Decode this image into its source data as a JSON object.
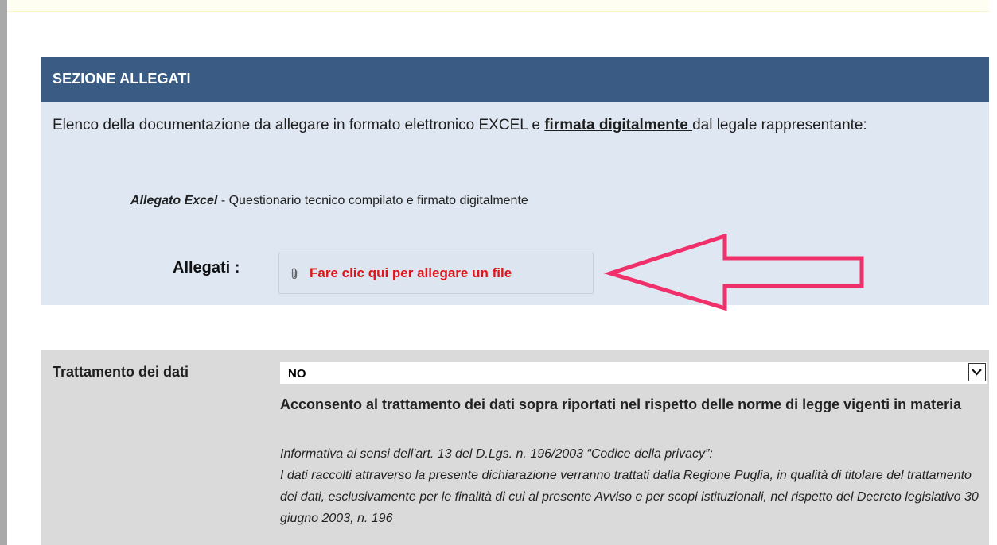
{
  "section": {
    "title": "SEZIONE ALLEGATI",
    "intro_before": "Elenco della documentazione da allegare in formato elettronico EXCEL e ",
    "intro_emphasis": "firmata digitalmente ",
    "intro_after": "dal legale rappresentante:",
    "item_title": "Allegato Excel",
    "item_desc": " - Questionario tecnico compilato e firmato digitalmente",
    "attach_label": "Allegati :",
    "attach_link": "Fare clic qui per allegare un file"
  },
  "privacy": {
    "label": "Trattamento dei dati",
    "selected": "NO",
    "consent": "Acconsento al trattamento dei dati sopra riportati nel rispetto delle norme di legge vigenti in materia",
    "note_heading": "Informativa ai sensi dell'art. 13 del D.Lgs. n. 196/2003 “Codice della privacy”:",
    "note_body": "I dati raccolti attraverso la presente dichiarazione verranno trattati dalla Regione Puglia, in qualità di titolare del trattamento dei dati, esclusivamente per le finalità di cui al presente Avviso e per scopi istituzionali, nel rispetto del Decreto legislativo 30 giugno 2003, n. 196"
  },
  "icons": {
    "attach": "paperclip-icon",
    "dropdown": "chevron-down-icon",
    "annotation": "arrow-left-icon"
  },
  "colors": {
    "header_bg": "#3a5c84",
    "section_bg": "#dfe8f2",
    "link_red": "#e0151a",
    "arrow_pink": "#f0306a",
    "gray_bg": "#dadada"
  }
}
